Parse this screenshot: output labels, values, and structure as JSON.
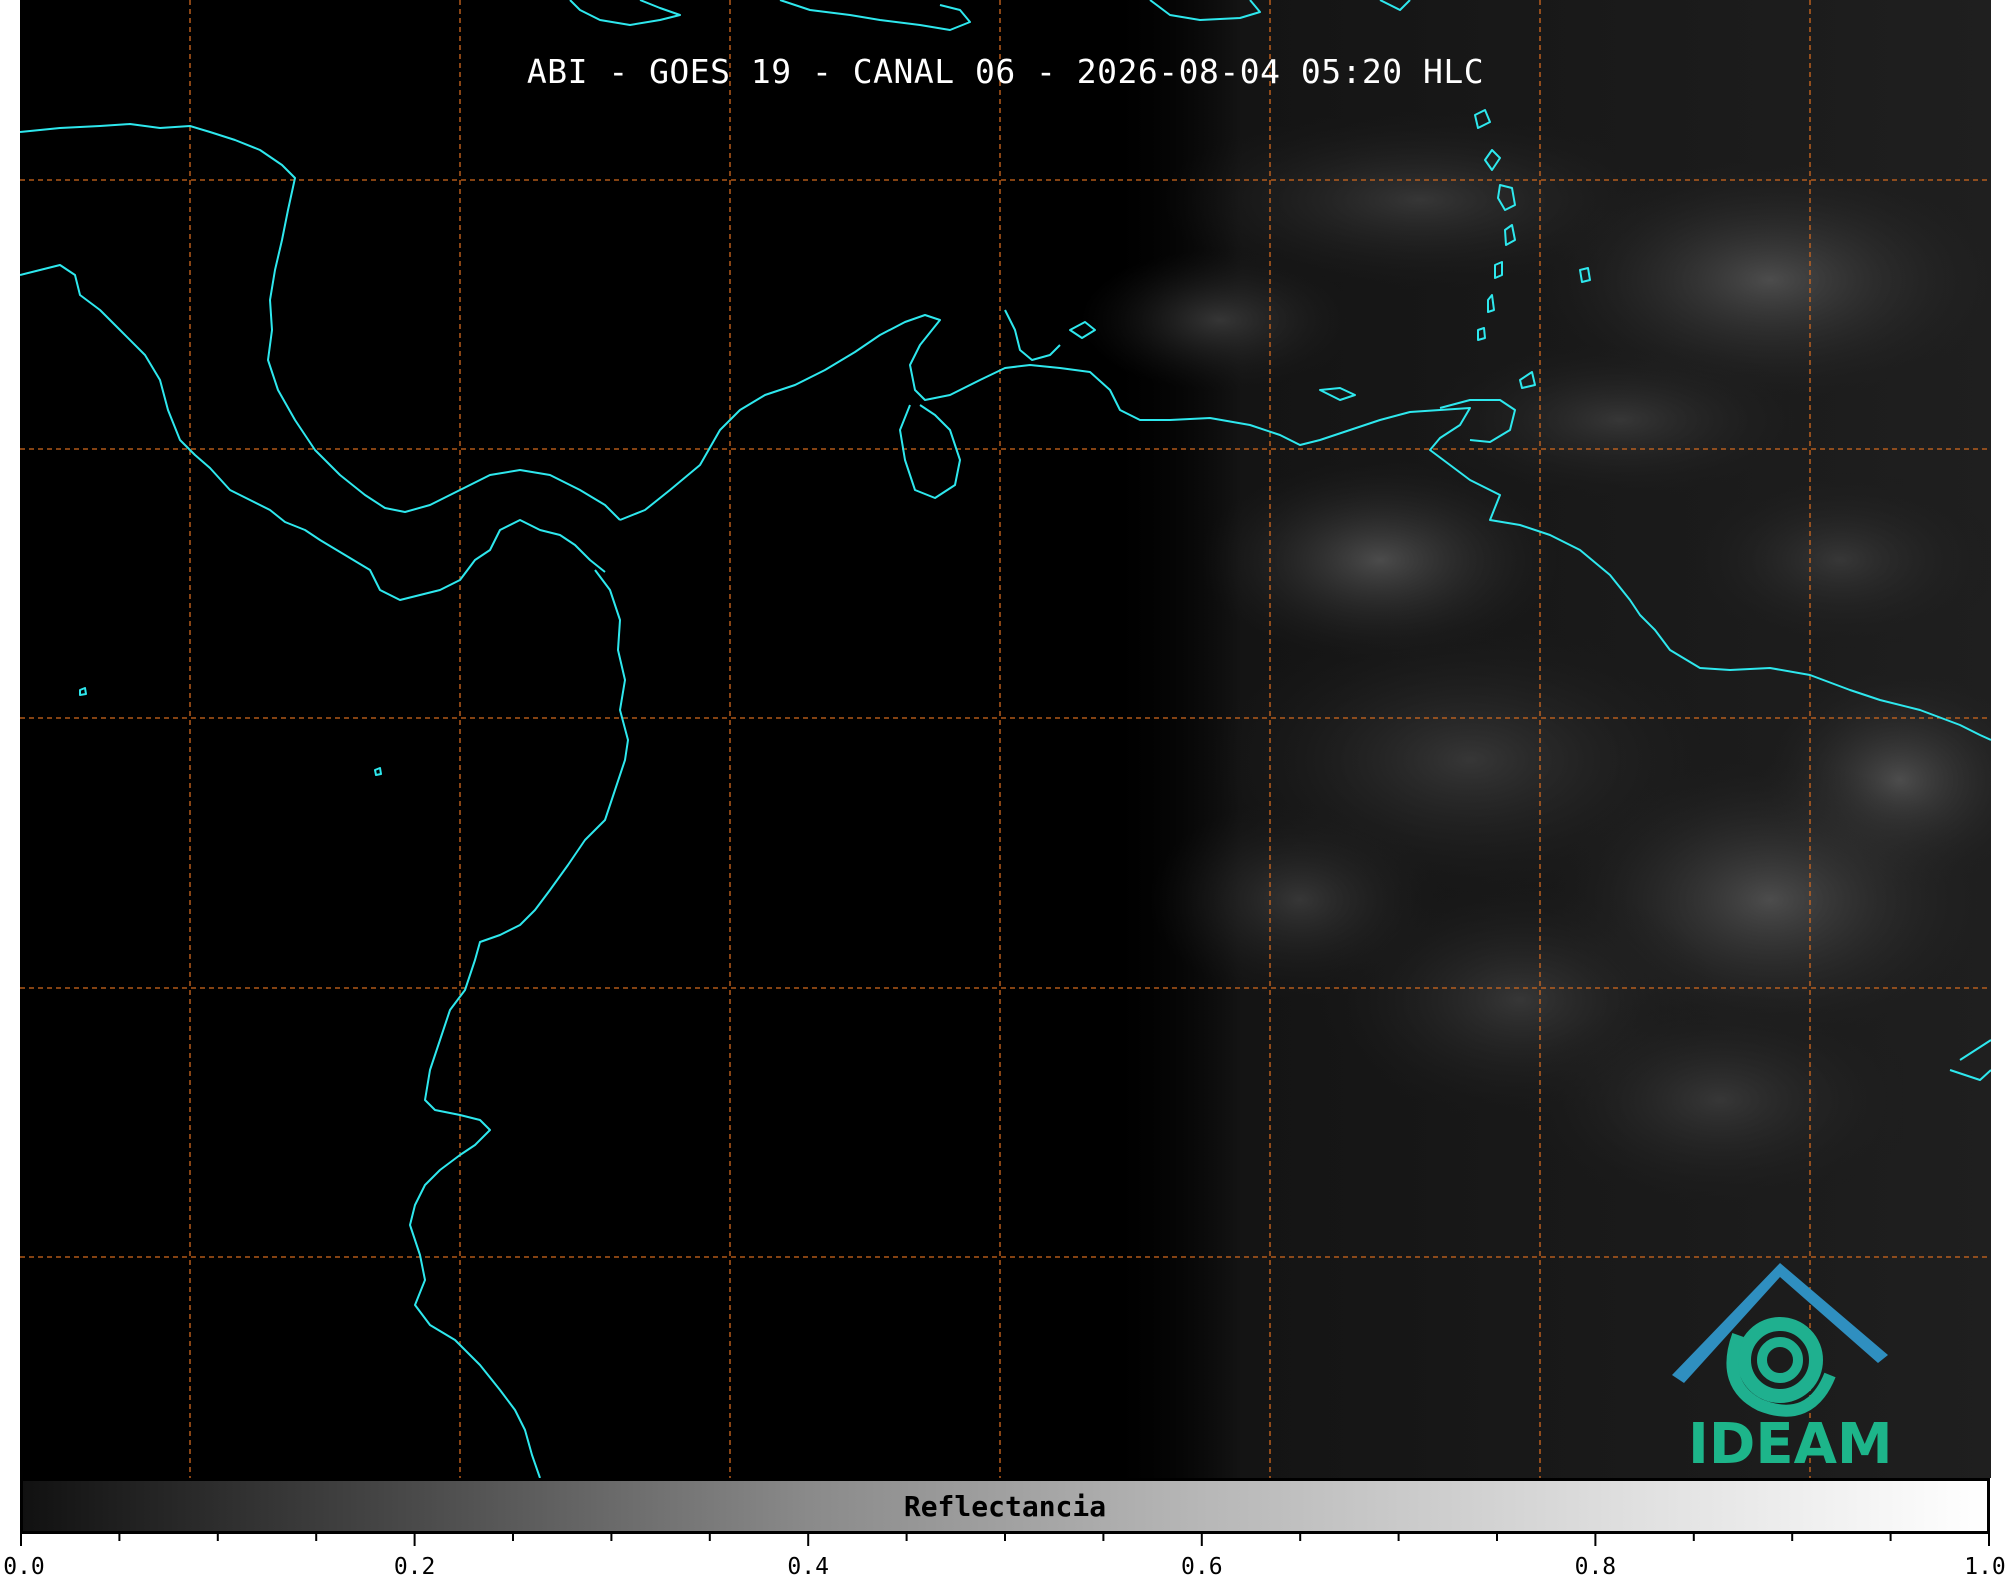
{
  "title": "ABI - GOES 19 - CANAL 06 - 2026-08-04 05:20 HLC",
  "colorbar": {
    "label": "Reflectancia",
    "min": 0.0,
    "max": 1.0,
    "tick_labels": [
      "0.0",
      "0.2",
      "0.4",
      "0.6",
      "0.8",
      "1.0"
    ],
    "tick_values": [
      0.0,
      0.2,
      0.4,
      0.6,
      0.8,
      1.0
    ],
    "minor_tick_step": 0.05
  },
  "logo": {
    "text": "IDEAM",
    "roof_color": "#2f8fc0",
    "swirl_color": "#1fb08f",
    "text_color": "#1db58a"
  },
  "colors": {
    "coastline": "#2ee8ee",
    "gridline": "#d2691e",
    "background": "#000000"
  }
}
